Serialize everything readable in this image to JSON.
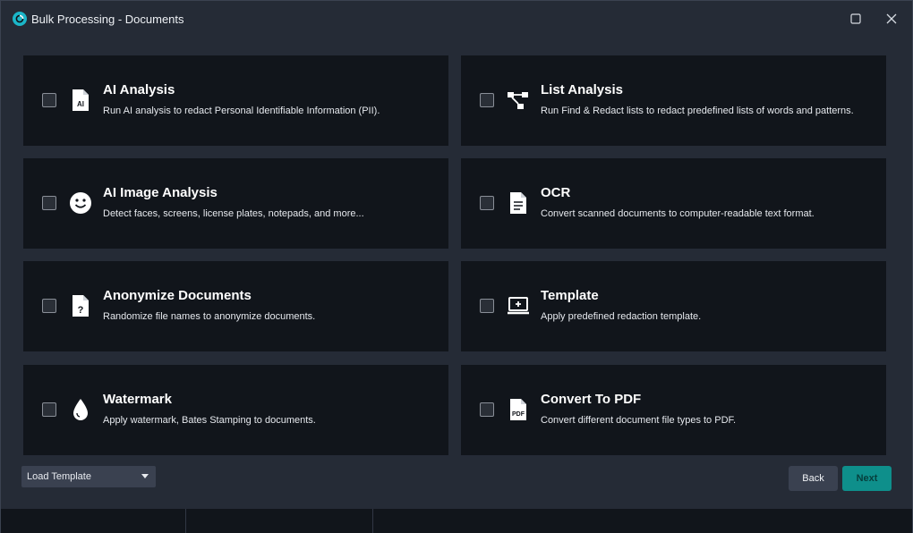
{
  "window": {
    "title": "Bulk Processing - Documents"
  },
  "icons": {
    "app": "app-logo-icon",
    "maximize": "maximize-icon",
    "close": "close-icon"
  },
  "options": [
    {
      "title": "AI Analysis",
      "description": "Run AI analysis to redact Personal Identifiable Information (PII).",
      "icon": "ai-document-icon",
      "icon_text": "AI",
      "checked": false
    },
    {
      "title": "List Analysis",
      "description": "Run Find & Redact lists to redact predefined lists of words and patterns.",
      "icon": "list-tree-icon",
      "checked": false
    },
    {
      "title": "AI Image Analysis",
      "description": "Detect faces, screens, license plates, notepads, and more...",
      "icon": "face-icon",
      "checked": false
    },
    {
      "title": "OCR",
      "description": "Convert scanned documents to computer-readable text format.",
      "icon": "text-document-icon",
      "checked": false
    },
    {
      "title": "Anonymize Documents",
      "description": "Randomize file names to anonymize documents.",
      "icon": "question-document-icon",
      "icon_text": "?",
      "checked": false
    },
    {
      "title": "Template",
      "description": "Apply predefined redaction template.",
      "icon": "template-icon",
      "checked": false
    },
    {
      "title": "Watermark",
      "description": "Apply watermark, Bates Stamping to documents.",
      "icon": "water-drop-icon",
      "checked": false
    },
    {
      "title": "Convert To PDF",
      "description": "Convert different document file types to PDF.",
      "icon": "pdf-document-icon",
      "icon_text": "PDF",
      "checked": false
    }
  ],
  "footer": {
    "load_template_label": "Load Template",
    "back_label": "Back",
    "next_label": "Next"
  },
  "colors": {
    "accent": "#0e8f8b",
    "card_bg": "#11151b",
    "window_bg": "#252b36"
  }
}
